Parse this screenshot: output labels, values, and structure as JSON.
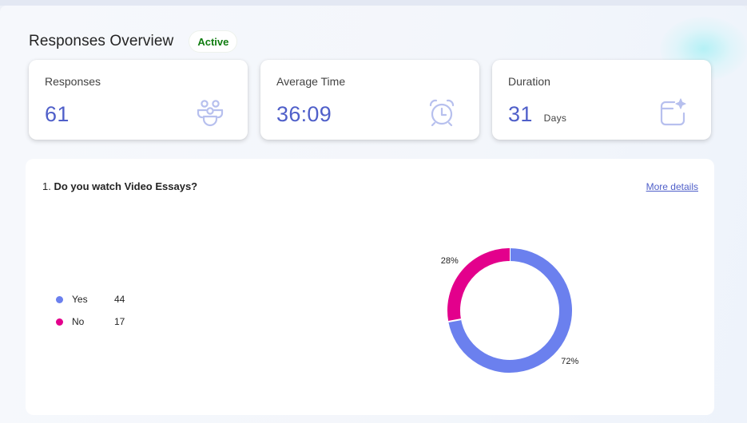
{
  "header": {
    "title": "Responses Overview",
    "status": "Active"
  },
  "cards": [
    {
      "label": "Responses",
      "value": "61",
      "unit": "",
      "icon": "people-group-icon"
    },
    {
      "label": "Average Time",
      "value": "36:09",
      "unit": "",
      "icon": "alarm-clock-icon"
    },
    {
      "label": "Duration",
      "value": "31",
      "unit": "Days",
      "icon": "calendar-sparkle-icon"
    }
  ],
  "question": {
    "number": "1.",
    "text": "Do you watch Video Essays?",
    "more_details": "More details"
  },
  "legend": [
    {
      "label": "Yes",
      "count": "44"
    },
    {
      "label": "No",
      "count": "17"
    }
  ],
  "chart_data": {
    "type": "pie",
    "categories": [
      "Yes",
      "No"
    ],
    "values": [
      44,
      17
    ],
    "percent_labels": [
      "72%",
      "28%"
    ],
    "colors": [
      "#6b80ee",
      "#e3008c"
    ],
    "donut": true,
    "legend_position": "left"
  },
  "colors": {
    "accent": "#4f5fc9",
    "active_badge_text": "#107c10"
  }
}
